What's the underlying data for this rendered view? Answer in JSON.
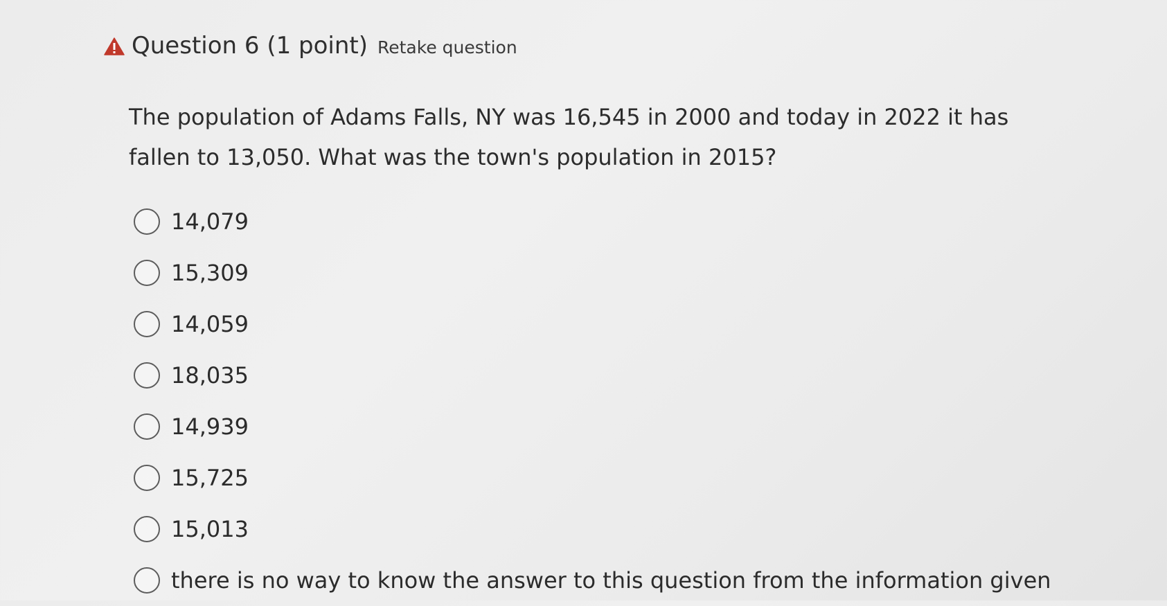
{
  "question": {
    "title": "Question 6 (1 point)",
    "retake_label": "Retake question",
    "warning_icon": "warning-triangle-icon",
    "warning_color": "#c0392b",
    "text": "The population of Adams Falls, NY was 16,545 in 2000 and today in 2022 it has fallen to 13,050.  What was the town's population in 2015?"
  },
  "options": [
    {
      "label": "14,079"
    },
    {
      "label": "15,309"
    },
    {
      "label": "14,059"
    },
    {
      "label": "18,035"
    },
    {
      "label": "14,939"
    },
    {
      "label": "15,725"
    },
    {
      "label": "15,013"
    },
    {
      "label": "there is no way to know the answer to this question from the information given"
    }
  ]
}
